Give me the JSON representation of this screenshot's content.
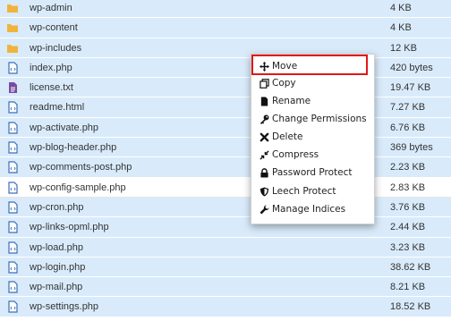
{
  "files": [
    {
      "name": "wp-admin",
      "size": "4 KB",
      "type": "folder"
    },
    {
      "name": "wp-content",
      "size": "4 KB",
      "type": "folder"
    },
    {
      "name": "wp-includes",
      "size": "12 KB",
      "type": "folder"
    },
    {
      "name": "index.php",
      "size": "420 bytes",
      "type": "code"
    },
    {
      "name": "license.txt",
      "size": "19.47 KB",
      "type": "text"
    },
    {
      "name": "readme.html",
      "size": "7.27 KB",
      "type": "code"
    },
    {
      "name": "wp-activate.php",
      "size": "6.76 KB",
      "type": "code"
    },
    {
      "name": "wp-blog-header.php",
      "size": "369 bytes",
      "type": "code"
    },
    {
      "name": "wp-comments-post.php",
      "size": "2.23 KB",
      "type": "code"
    },
    {
      "name": "wp-config-sample.php",
      "size": "2.83 KB",
      "type": "code"
    },
    {
      "name": "wp-cron.php",
      "size": "3.76 KB",
      "type": "code"
    },
    {
      "name": "wp-links-opml.php",
      "size": "2.44 KB",
      "type": "code"
    },
    {
      "name": "wp-load.php",
      "size": "3.23 KB",
      "type": "code"
    },
    {
      "name": "wp-login.php",
      "size": "38.62 KB",
      "type": "code"
    },
    {
      "name": "wp-mail.php",
      "size": "8.21 KB",
      "type": "code"
    },
    {
      "name": "wp-settings.php",
      "size": "18.52 KB",
      "type": "code"
    }
  ],
  "context_menu": {
    "items": [
      {
        "label": "Move",
        "icon": "move-icon"
      },
      {
        "label": "Copy",
        "icon": "copy-icon"
      },
      {
        "label": "Rename",
        "icon": "file-icon"
      },
      {
        "label": "Change Permissions",
        "icon": "key-icon"
      },
      {
        "label": "Delete",
        "icon": "x-icon"
      },
      {
        "label": "Compress",
        "icon": "compress-icon"
      },
      {
        "label": "Password Protect",
        "icon": "lock-icon"
      },
      {
        "label": "Leech Protect",
        "icon": "shield-icon"
      },
      {
        "label": "Manage Indices",
        "icon": "wrench-icon"
      }
    ]
  },
  "colors": {
    "row_selected": "#d9ebfb",
    "folder": "#f0b43c",
    "code_icon": "#3b6fb6",
    "text_icon": "#7a4aa3",
    "highlight_border": "#e01818"
  }
}
